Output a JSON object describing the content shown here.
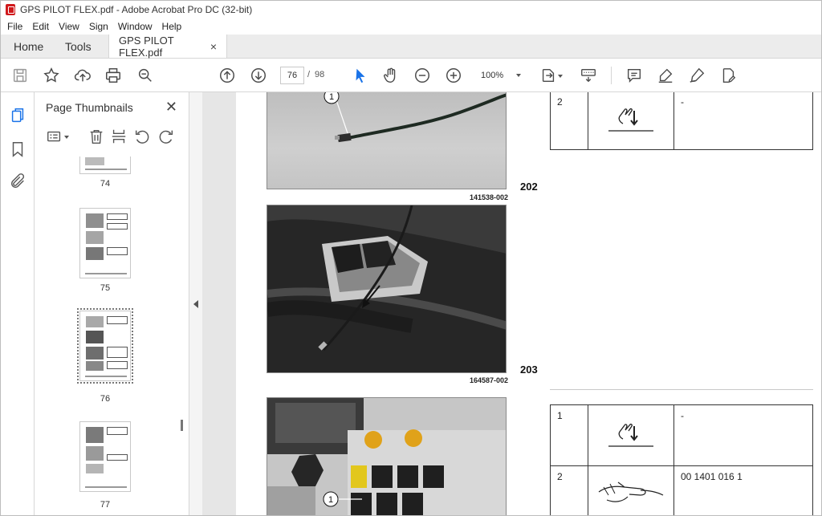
{
  "window": {
    "title": "GPS PILOT FLEX.pdf - Adobe Acrobat Pro DC (32-bit)"
  },
  "menu": [
    "File",
    "Edit",
    "View",
    "Sign",
    "Window",
    "Help"
  ],
  "tabs": {
    "home": "Home",
    "tools": "Tools",
    "doc": "GPS PILOT FLEX.pdf",
    "close": "×"
  },
  "toolbar": {
    "page_current": "76",
    "page_separator": "/",
    "page_total": "98",
    "zoom": "100%"
  },
  "panel": {
    "title": "Page Thumbnails",
    "close": "✕",
    "thumbnails": [
      {
        "label": "74"
      },
      {
        "label": "75"
      },
      {
        "label": "76",
        "selected": true
      },
      {
        "label": "77"
      }
    ]
  },
  "document": {
    "figures": [
      {
        "number": "202",
        "caption": "141538-002",
        "callout": "1"
      },
      {
        "number": "203",
        "caption": "164587-002"
      },
      {
        "callout": "1"
      }
    ],
    "table_top": [
      {
        "pos": "2",
        "icon": "hand-plug-down-icon",
        "text": "-"
      }
    ],
    "table_bottom": [
      {
        "pos": "1",
        "icon": "hand-plug-down-icon",
        "text": "-"
      },
      {
        "pos": "2",
        "icon": "hand-cable-icon",
        "text": "00 1401 016 1"
      }
    ]
  }
}
